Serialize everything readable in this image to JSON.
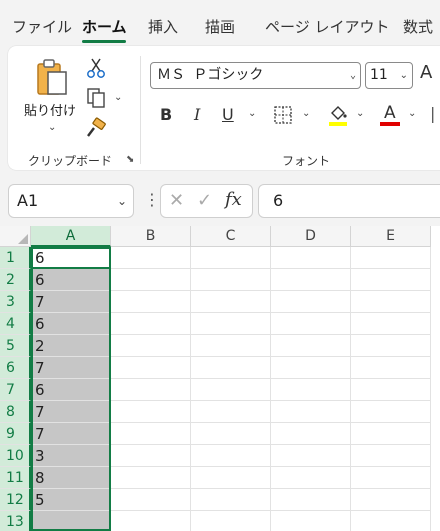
{
  "tabs": [
    "ファイル",
    "ホーム",
    "挿入",
    "描画",
    "ページ レイアウト",
    "数式"
  ],
  "active_tab": "ホーム",
  "clipboard": {
    "paste_label": "貼り付け",
    "group_label": "クリップボード"
  },
  "font": {
    "name": "ＭＳ Ｐゴシック",
    "size": "11",
    "group_label": "フォント",
    "bold": "B",
    "italic": "I",
    "underline": "U",
    "font_color_letter": "A"
  },
  "colors": {
    "accent": "#127c45",
    "highlight": "#ffff00",
    "font_color": "#e00000",
    "selection_fill": "#c6c6c6"
  },
  "formula_bar": {
    "name_box": "A1",
    "fx_label": "fx",
    "value": "6"
  },
  "columns": [
    "A",
    "B",
    "C",
    "D",
    "E"
  ],
  "rows": [
    "1",
    "2",
    "3",
    "4",
    "5",
    "6",
    "7",
    "8",
    "9",
    "10",
    "11",
    "12",
    "13"
  ],
  "column_a_values": [
    "6",
    "6",
    "7",
    "6",
    "2",
    "7",
    "6",
    "7",
    "7",
    "3",
    "8",
    "5",
    ""
  ]
}
